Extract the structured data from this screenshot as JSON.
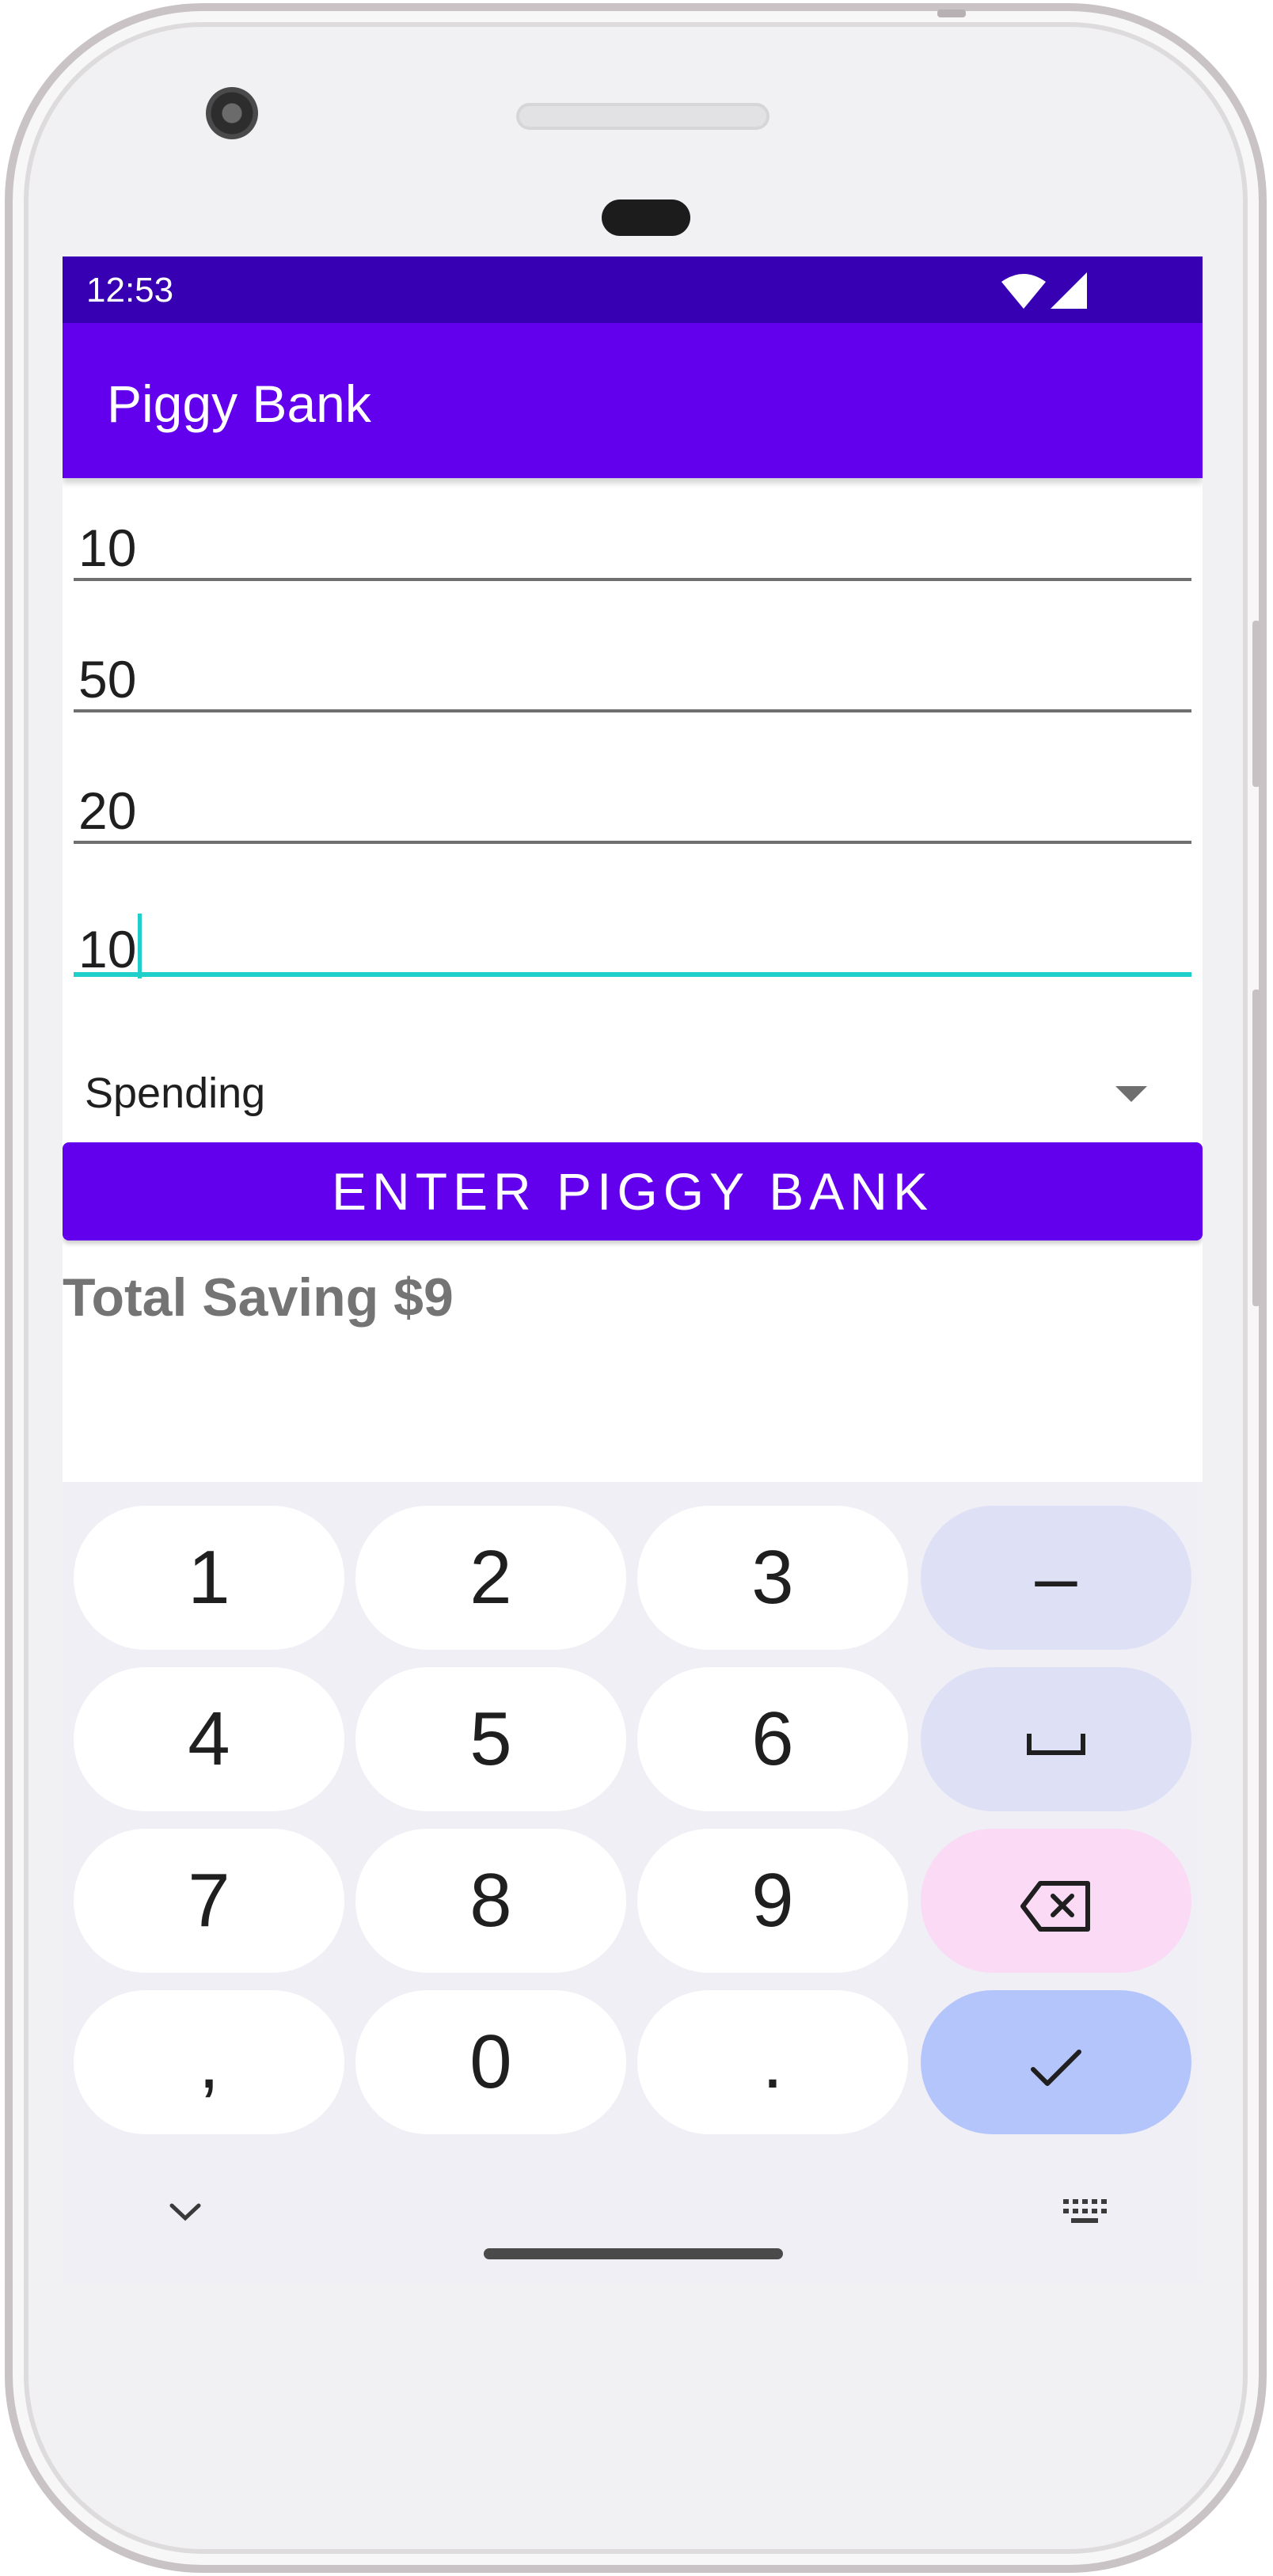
{
  "status_bar": {
    "time": "12:53"
  },
  "app_bar": {
    "title": "Piggy Bank"
  },
  "fields": [
    {
      "value": "10"
    },
    {
      "value": "50"
    },
    {
      "value": "20"
    },
    {
      "value": "10"
    }
  ],
  "spinner": {
    "selected": "Spending"
  },
  "enter_button": {
    "label": "ENTER PIGGY BANK"
  },
  "total": {
    "text": "Total Saving $9"
  },
  "keyboard": {
    "keys": [
      {
        "label": "1"
      },
      {
        "label": "2"
      },
      {
        "label": "3"
      },
      {
        "label": "–"
      },
      {
        "label": "4"
      },
      {
        "label": "5"
      },
      {
        "label": "6"
      },
      {
        "label": "space"
      },
      {
        "label": "7"
      },
      {
        "label": "8"
      },
      {
        "label": "9"
      },
      {
        "label": "backspace"
      },
      {
        "label": ","
      },
      {
        "label": "0"
      },
      {
        "label": "."
      },
      {
        "label": "done"
      }
    ]
  },
  "colors": {
    "status_bar": "#3700b3",
    "primary": "#6200ee",
    "accent": "#1ecfca",
    "total_text": "#747474"
  }
}
